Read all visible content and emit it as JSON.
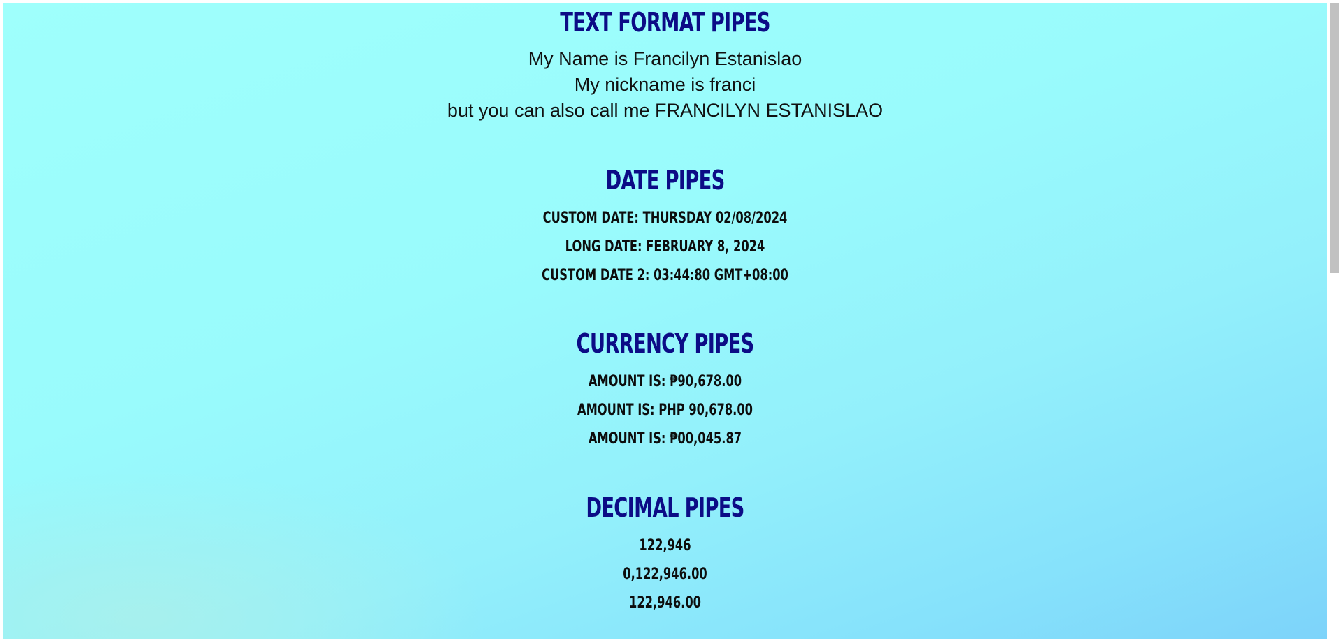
{
  "text_format": {
    "title": "TEXT FORMAT PIPES",
    "lines": [
      "My Name is Francilyn Estanislao",
      "My nickname is franci",
      "but you can also call me FRANCILYN ESTANISLAO"
    ]
  },
  "date": {
    "title": "DATE PIPES",
    "lines": [
      "CUSTOM DATE: THURSDAY 02/08/2024",
      "LONG DATE: FEBRUARY 8, 2024",
      "CUSTOM DATE 2: 03:44:80 GMT+08:00"
    ]
  },
  "currency": {
    "title": "CURRENCY PIPES",
    "lines": [
      "AMOUNT IS: ₱90,678.00",
      "AMOUNT IS: PHP 90,678.00",
      "AMOUNT IS: ₱00,045.87"
    ]
  },
  "decimal": {
    "title": "DECIMAL PIPES",
    "lines": [
      "122,946",
      "0,122,946.00",
      "122,946.00"
    ]
  },
  "colors": {
    "heading": "#0c0c86",
    "background_start": "#9ffffc",
    "background_end": "#7dd3fa"
  }
}
